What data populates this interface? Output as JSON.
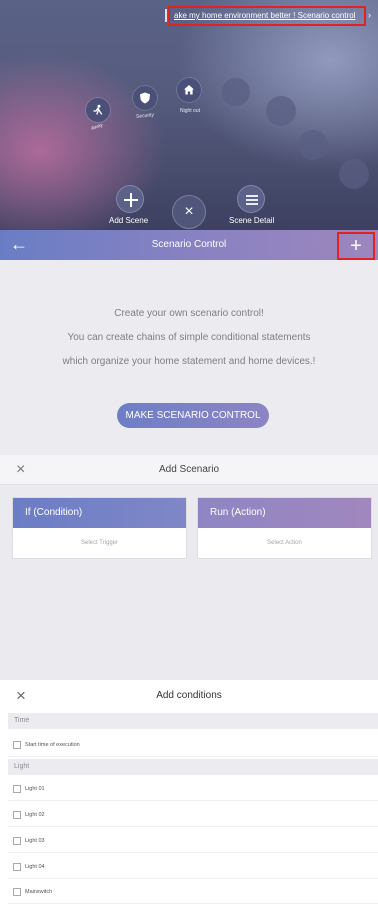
{
  "scene": {
    "banner_text": "ake my home environment better ! Scenario control",
    "banner_arrow": "›",
    "dial_items": [
      {
        "label": "Away",
        "icon": "person-walking-icon"
      },
      {
        "label": "Security",
        "icon": "shield-icon"
      },
      {
        "label": "Night out",
        "icon": "home-icon"
      }
    ],
    "add_scene_label": "Add Scene",
    "close_symbol": "×",
    "scene_detail_label": "Scene Detail"
  },
  "control": {
    "title": "Scenario Control",
    "back_symbol": "←",
    "add_symbol": "+",
    "line1": "Create your own scenario control!",
    "line2": "You can create chains of simple conditional statements",
    "line3": "which organize your home statement and home devices.!",
    "make_button": "MAKE SCENARIO CONTROL"
  },
  "add_scenario": {
    "title": "Add Scenario",
    "close_symbol": "×",
    "if_title": "If (Condition)",
    "if_sub": "Select Trigger",
    "run_title": "Run (Action)",
    "run_sub": "Select Action"
  },
  "conditions": {
    "title": "Add conditions",
    "close_symbol": "×",
    "time_header": "Time",
    "time_items": [
      "Start time of execution"
    ],
    "light_header": "Light",
    "light_items": [
      "Light 01",
      "Light 02",
      "Light 03",
      "Light 04",
      "Mainswitch"
    ]
  }
}
